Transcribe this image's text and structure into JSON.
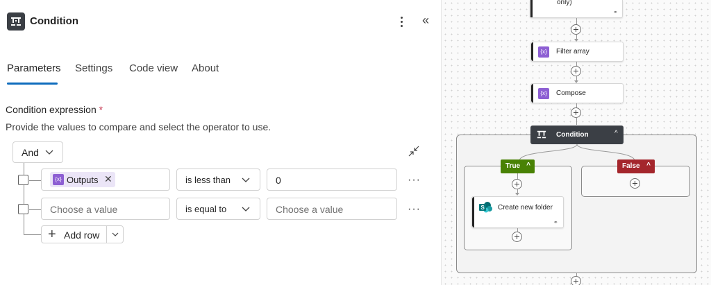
{
  "panel": {
    "title": "Condition",
    "collapse_glyph": "«",
    "tabs": [
      {
        "label": "Parameters",
        "active": true
      },
      {
        "label": "Settings",
        "active": false
      },
      {
        "label": "Code view",
        "active": false
      },
      {
        "label": "About",
        "active": false
      }
    ],
    "condition_label": "Condition expression",
    "required_mark": "*",
    "description": "Provide the values to compare and select the operator to use.",
    "group_operator": "And",
    "rows": [
      {
        "left_token": "Outputs",
        "operator": "is less than",
        "right_value": "0"
      },
      {
        "left_placeholder": "Choose a value",
        "operator": "is equal to",
        "right_placeholder": "Choose a value"
      }
    ],
    "row_more": "···",
    "add_row_label": "Add row"
  },
  "canvas": {
    "top_node_label": "only)",
    "nodes": [
      {
        "label": "Filter array",
        "icon": "data-operation-icon"
      },
      {
        "label": "Compose",
        "icon": "data-operation-icon"
      }
    ],
    "condition_node": "Condition",
    "true_label": "True",
    "false_label": "False",
    "true_action": "Create new folder",
    "colors": {
      "true_badge": "#498205",
      "false_badge": "#a4262c",
      "condition_node": "#3b3f45",
      "accent": "#0f6cbd",
      "data_operation": "#8d5fd3"
    }
  }
}
